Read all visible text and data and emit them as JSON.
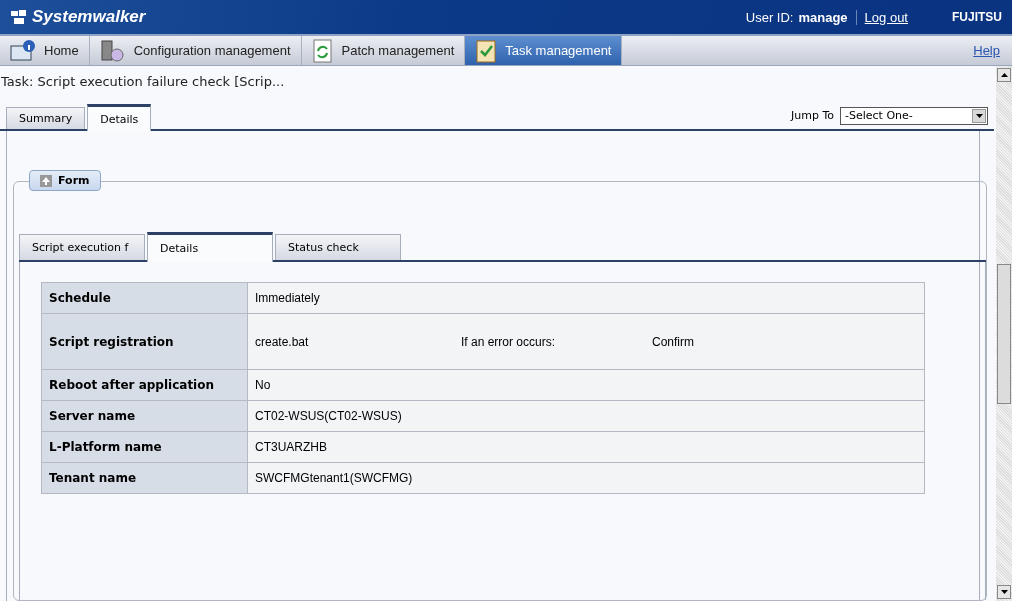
{
  "header": {
    "brand": "Systemwalker",
    "user_label": "User ID:",
    "user": "manage",
    "logout": "Log out",
    "vendor": "FUJITSU"
  },
  "nav": [
    {
      "label": "Home",
      "kind": "home",
      "selected": false
    },
    {
      "label": "Configuration management",
      "kind": "config",
      "selected": false
    },
    {
      "label": "Patch management",
      "kind": "patch",
      "selected": false
    },
    {
      "label": "Task management",
      "kind": "task",
      "selected": true
    }
  ],
  "help": "Help",
  "page_title": "Task: Script execution failure check [Scrip...",
  "tabs": [
    {
      "label": "Summary",
      "selected": false
    },
    {
      "label": "Details",
      "selected": true
    }
  ],
  "jump_to": {
    "label": "Jump To",
    "value": "-Select One-"
  },
  "form": {
    "title": "Form",
    "expanded": true,
    "tabs": [
      {
        "label": "Script execution f",
        "selected": false
      },
      {
        "label": "Details",
        "selected": true
      },
      {
        "label": "Status check",
        "selected": false
      }
    ],
    "rows": [
      {
        "label": "Schedule",
        "values": [
          "Immediately"
        ]
      },
      {
        "label": "Script registration",
        "values": [
          "create.bat",
          "If an error occurs:",
          "Confirm"
        ]
      },
      {
        "label": "Reboot after application",
        "values": [
          "No"
        ]
      },
      {
        "label": "Server name",
        "values": [
          "CT02-WSUS(CT02-WSUS)"
        ]
      },
      {
        "label": "L-Platform name",
        "values": [
          "CT3UARZHB"
        ]
      },
      {
        "label": "Tenant name",
        "values": [
          "SWCFMGtenant1(SWCFMG)"
        ]
      }
    ]
  }
}
